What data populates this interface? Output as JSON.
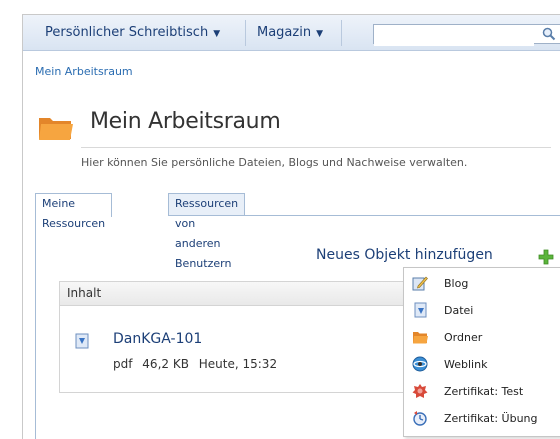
{
  "nav": {
    "items": [
      {
        "label": "Persönlicher Schreibtisch"
      },
      {
        "label": "Magazin"
      }
    ],
    "search": {
      "value": "",
      "placeholder": ""
    }
  },
  "breadcrumb": "Mein Arbeitsraum",
  "page": {
    "title": "Mein Arbeitsraum",
    "subtitle": "Hier können Sie persönliche Dateien, Blogs und Nachweise verwalten."
  },
  "tabs": [
    {
      "label": "Meine Ressourcen",
      "active": true
    },
    {
      "label": "Ressourcen von anderen Benutzern",
      "active": false
    }
  ],
  "toolbar": {
    "new_object_label": "Neues Objekt hinzufügen"
  },
  "table": {
    "header": "Inhalt",
    "rows": [
      {
        "name": "DanKGA-101",
        "type": "pdf",
        "size": "46,2 KB",
        "date": "Heute, 15:32",
        "icon": "pdf-file-icon"
      }
    ]
  },
  "menu": {
    "items": [
      {
        "label": "Blog",
        "icon": "blog-icon"
      },
      {
        "label": "Datei",
        "icon": "file-icon"
      },
      {
        "label": "Ordner",
        "icon": "folder-icon"
      },
      {
        "label": "Weblink",
        "icon": "weblink-icon"
      },
      {
        "label": "Zertifikat: Test",
        "icon": "certificate-test-icon"
      },
      {
        "label": "Zertifikat: Übung",
        "icon": "certificate-exercise-icon"
      }
    ]
  },
  "colors": {
    "nav_gradient": [
      "#eef3fa",
      "#d9e4f2"
    ],
    "link": "#1c3f77",
    "accent_folder": "#f29b2a",
    "plus_green": "#5bb53b"
  }
}
